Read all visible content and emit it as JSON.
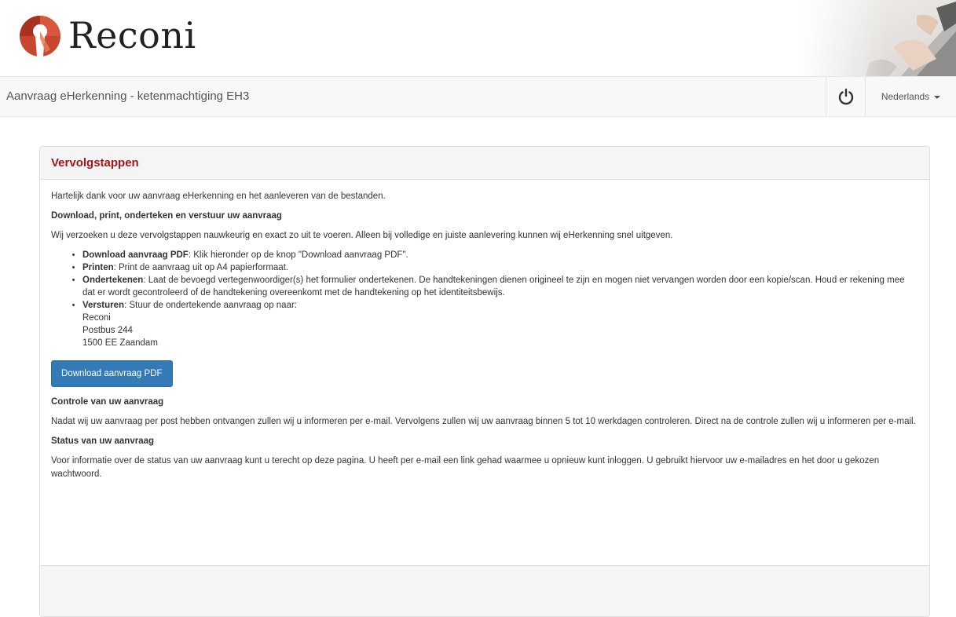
{
  "brand": {
    "name": "Reconi",
    "accent_color": "#a3161b",
    "logo_icon": "reconi-logo-icon",
    "header_image": "laptop-hands-photo"
  },
  "navbar": {
    "title": "Aanvraag eHerkenning - ketenmachtiging EH3",
    "power_icon": "power-icon",
    "language": "Nederlands",
    "language_icon": "caret-down-icon"
  },
  "panel": {
    "title": "Vervolgstappen",
    "intro": "Hartelijk dank voor uw aanvraag eHerkenning en het aanleveren van de bestanden.",
    "section1_heading": "Download, print, onderteken en verstuur uw aanvraag",
    "section1_text": "Wij verzoeken u deze vervolgstappen nauwkeurig en exact zo uit te voeren. Alleen bij volledige en juiste aanlevering kunnen wij eHerkenning snel uitgeven.",
    "steps": [
      {
        "label": "Download aanvraag PDF",
        "text": ": Klik hieronder op de knop \"Download aanvraag PDF\"."
      },
      {
        "label": "Printen",
        "text": ": Print de aanvraag uit op A4 papierformaat."
      },
      {
        "label": "Ondertekenen",
        "text": ": Laat de bevoegd vertegenwoordiger(s) het formulier ondertekenen. De handtekeningen dienen origineel te zijn en mogen niet vervangen worden door een kopie/scan. Houd er rekening mee dat er wordt gecontroleerd of de handtekening overeenkomt met de handtekening op het identiteitsbewijs."
      },
      {
        "label": "Versturen",
        "text": ": Stuur de ondertekende aanvraag op naar:"
      }
    ],
    "address": [
      "Reconi",
      "Postbus 244",
      "1500 EE Zaandam"
    ],
    "download_button": "Download aanvraag PDF",
    "button_color": "#337ab7",
    "section2_heading": "Controle van uw aanvraag",
    "section2_text": "Nadat wij uw aanvraag per post hebben ontvangen zullen wij u informeren per e-mail. Vervolgens zullen wij uw aanvraag binnen 5 tot 10 werkdagen controleren. Direct na de controle zullen wij u informeren per e-mail.",
    "section3_heading": "Status van uw aanvraag",
    "section3_text": "Voor informatie over de status van uw aanvraag kunt u terecht op deze pagina. U heeft per e-mail een link gehad waarmee u opnieuw kunt inloggen. U gebruikt hiervoor uw e-mailadres en het door u gekozen wachtwoord."
  }
}
